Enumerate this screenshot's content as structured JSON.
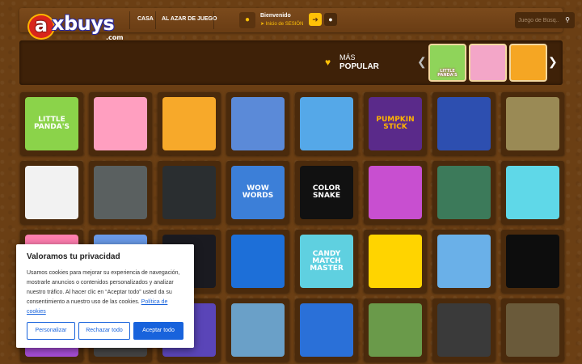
{
  "header": {
    "logo_letter": "a",
    "logo_text": "xbuys",
    "logo_dotcom": ".com",
    "nav": [
      {
        "label": "CASA"
      },
      {
        "label": "AL AZAR DE JUEGO"
      }
    ],
    "welcome": "Bienvenido",
    "login": "Inicio de SESIÓN",
    "search_placeholder": "Juego de Búsq..."
  },
  "popular": {
    "title_line1": "MÁS",
    "title_line2": "POPULAR",
    "thumbs": [
      {
        "label": "LITTLE PANDA'S",
        "bg": "#8fd45a"
      },
      {
        "label": "",
        "bg": "#f3a6c8"
      },
      {
        "label": "",
        "bg": "#f5a623"
      }
    ]
  },
  "games": [
    {
      "label": "LITTLE PANDA'S",
      "bg": "#8bd34a",
      "fg": "#ffffff"
    },
    {
      "label": "",
      "bg": "#ff9fc0",
      "fg": "#ffffff"
    },
    {
      "label": "",
      "bg": "#f7a92a",
      "fg": "#ffffff"
    },
    {
      "label": "",
      "bg": "#5b8ad8",
      "fg": "#ffffff"
    },
    {
      "label": "",
      "bg": "#55a8e8",
      "fg": "#ffffff"
    },
    {
      "label": "PUMPKIN STICK",
      "bg": "#5a2a8a",
      "fg": "#ffb300"
    },
    {
      "label": "",
      "bg": "#2d4fb0",
      "fg": "#ffffff"
    },
    {
      "label": "",
      "bg": "#9a8a55",
      "fg": "#ffffff"
    },
    {
      "label": "",
      "bg": "#f2f2f2",
      "fg": "#333333"
    },
    {
      "label": "",
      "bg": "#5a6060",
      "fg": "#ffffff"
    },
    {
      "label": "",
      "bg": "#2a2e30",
      "fg": "#ffffff"
    },
    {
      "label": "WOW WORDS",
      "bg": "#3c7fd8",
      "fg": "#ffffff"
    },
    {
      "label": "COLOR SNAKE",
      "bg": "#111111",
      "fg": "#ffffff"
    },
    {
      "label": "",
      "bg": "#c84fd0",
      "fg": "#ffffff"
    },
    {
      "label": "",
      "bg": "#3c7a5a",
      "fg": "#ffffff"
    },
    {
      "label": "",
      "bg": "#5fd8e8",
      "fg": "#ffffff"
    },
    {
      "label": "",
      "bg": "#ff7fb0",
      "fg": "#ffffff"
    },
    {
      "label": "",
      "bg": "#6a9ae8",
      "fg": "#ffffff"
    },
    {
      "label": "",
      "bg": "#1a1a20",
      "fg": "#ffffff"
    },
    {
      "label": "",
      "bg": "#1d6fd8",
      "fg": "#ffffff"
    },
    {
      "label": "CANDY MATCH MASTER",
      "bg": "#5fd0e0",
      "fg": "#ffffff"
    },
    {
      "label": "",
      "bg": "#ffd400",
      "fg": "#333333"
    },
    {
      "label": "",
      "bg": "#6ab0e8",
      "fg": "#ffffff"
    },
    {
      "label": "",
      "bg": "#0d0d0d",
      "fg": "#ffffff"
    },
    {
      "label": "",
      "bg": "#a64dd6",
      "fg": "#ffffff"
    },
    {
      "label": "",
      "bg": "#444444",
      "fg": "#ffffff"
    },
    {
      "label": "",
      "bg": "#5a45b8",
      "fg": "#ffffff"
    },
    {
      "label": "",
      "bg": "#6aa0c8",
      "fg": "#ffffff"
    },
    {
      "label": "",
      "bg": "#2a70d8",
      "fg": "#ffffff"
    },
    {
      "label": "",
      "bg": "#6a9a4a",
      "fg": "#ffffff"
    },
    {
      "label": "",
      "bg": "#3a3a3a",
      "fg": "#ffffff"
    },
    {
      "label": "",
      "bg": "#6a5a3a",
      "fg": "#ffffff"
    }
  ],
  "cookie": {
    "title": "Valoramos tu privacidad",
    "body": "Usamos cookies para mejorar su experiencia de navegación, mostrarle anuncios o contenidos personalizados y analizar nuestro tráfico. Al hacer clic en “Aceptar todo” usted da su consentimiento a nuestro uso de las cookies.",
    "policy_link": "Política de cookies",
    "btn_customize": "Personalizar",
    "btn_reject": "Rechazar todo",
    "btn_accept": "Aceptar todo"
  }
}
